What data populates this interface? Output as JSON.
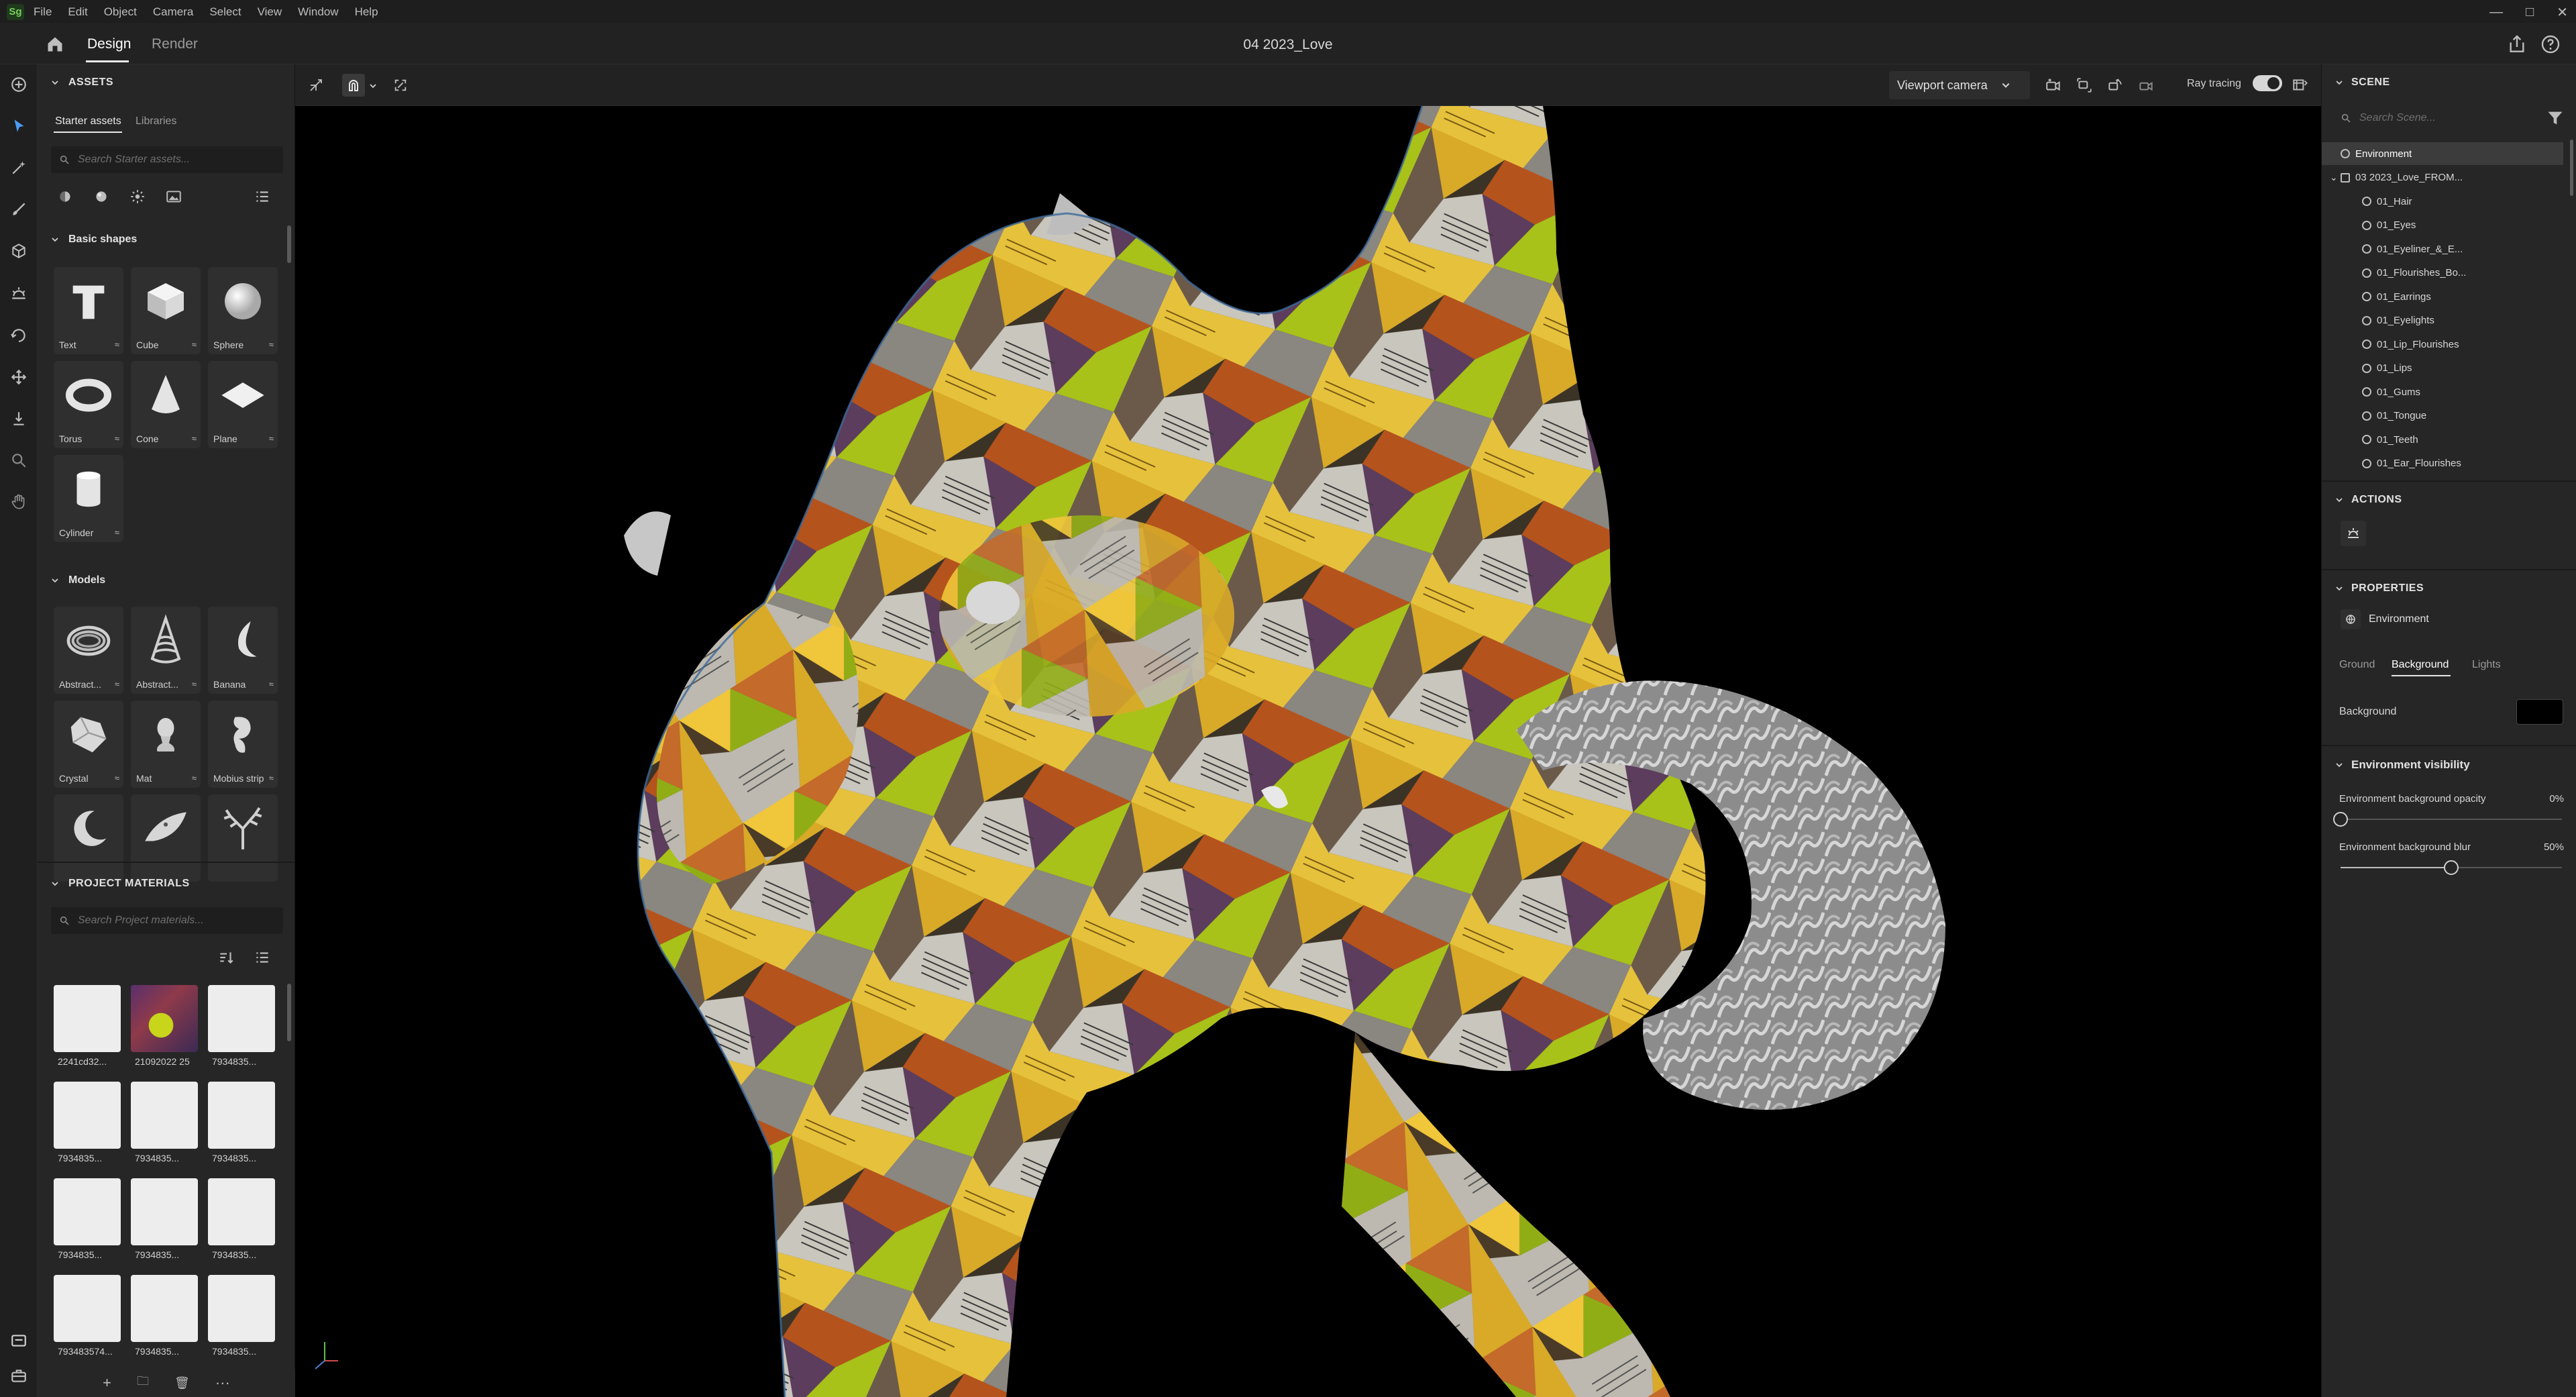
{
  "menubar": {
    "logo": "Sg",
    "items": [
      "File",
      "Edit",
      "Object",
      "Camera",
      "Select",
      "View",
      "Window",
      "Help"
    ],
    "window_controls": {
      "minimize": "—",
      "maximize": "□",
      "close": "✕"
    }
  },
  "titlebar": {
    "tabs": {
      "design": "Design",
      "render": "Render"
    },
    "active_tab": "Design",
    "document_title": "04 2023_Love"
  },
  "assets": {
    "title": "ASSETS",
    "tabs": {
      "starter": "Starter assets",
      "libraries": "Libraries"
    },
    "search_placeholder": "Search Starter assets...",
    "basic_shapes_title": "Basic shapes",
    "basic_shapes": [
      {
        "label": "Text",
        "icon": "text-shape-icon"
      },
      {
        "label": "Cube",
        "icon": "cube-shape-icon"
      },
      {
        "label": "Sphere",
        "icon": "sphere-shape-icon"
      },
      {
        "label": "Torus",
        "icon": "torus-shape-icon"
      },
      {
        "label": "Cone",
        "icon": "cone-shape-icon"
      },
      {
        "label": "Plane",
        "icon": "plane-shape-icon"
      },
      {
        "label": "Cylinder",
        "icon": "cylinder-shape-icon"
      }
    ],
    "models_title": "Models",
    "models": [
      {
        "label": "Abstract...",
        "icon": "abstract-ring-icon"
      },
      {
        "label": "Abstract...",
        "icon": "abstract-spiral-icon"
      },
      {
        "label": "Banana",
        "icon": "banana-icon"
      },
      {
        "label": "Crystal",
        "icon": "crystal-icon"
      },
      {
        "label": "Mat",
        "icon": "bust-icon"
      },
      {
        "label": "Mobius strip",
        "icon": "mobius-icon"
      },
      {
        "label": "",
        "icon": "crescent-icon"
      },
      {
        "label": "",
        "icon": "leaf-icon"
      },
      {
        "label": "",
        "icon": "coral-icon"
      }
    ],
    "project_materials_title": "PROJECT MATERIALS",
    "materials_search_placeholder": "Search Project materials...",
    "materials": [
      {
        "label": "2241cd32...",
        "swatch": "#ededed"
      },
      {
        "label": "21092022 25",
        "swatch": "texture"
      },
      {
        "label": "7934835...",
        "swatch": "#ededed"
      },
      {
        "label": "7934835...",
        "swatch": "#ededed"
      },
      {
        "label": "7934835...",
        "swatch": "#ededed"
      },
      {
        "label": "7934835...",
        "swatch": "#ededed"
      },
      {
        "label": "7934835...",
        "swatch": "#ededed"
      },
      {
        "label": "7934835...",
        "swatch": "#ededed"
      },
      {
        "label": "7934835...",
        "swatch": "#ededed"
      },
      {
        "label": "793483574...",
        "swatch": "#ededed"
      },
      {
        "label": "7934835...",
        "swatch": "#ededed"
      },
      {
        "label": "7934835...",
        "swatch": "#ededed"
      }
    ],
    "footer": {
      "add": "+",
      "folder": "🗀",
      "delete": "🗑",
      "more": "···"
    }
  },
  "viewport": {
    "camera_select": "Viewport camera",
    "ray_tracing_label": "Ray tracing",
    "ray_tracing_on": true
  },
  "scene": {
    "title": "SCENE",
    "search_placeholder": "Search Scene...",
    "items": [
      {
        "label": "Environment",
        "depth": 0,
        "selected": true,
        "expander": ""
      },
      {
        "label": "03 2023_Love_FROM...",
        "depth": 0,
        "selected": false,
        "expander": "⌄"
      },
      {
        "label": "01_Hair",
        "depth": 1,
        "selected": false,
        "expander": ""
      },
      {
        "label": "01_Eyes",
        "depth": 1,
        "selected": false,
        "expander": ""
      },
      {
        "label": "01_Eyeliner_&_E...",
        "depth": 1,
        "selected": false,
        "expander": ""
      },
      {
        "label": "01_Flourishes_Bo...",
        "depth": 1,
        "selected": false,
        "expander": ""
      },
      {
        "label": "01_Earrings",
        "depth": 1,
        "selected": false,
        "expander": ""
      },
      {
        "label": "01_Eyelights",
        "depth": 1,
        "selected": false,
        "expander": ""
      },
      {
        "label": "01_Lip_Flourishes",
        "depth": 1,
        "selected": false,
        "expander": ""
      },
      {
        "label": "01_Lips",
        "depth": 1,
        "selected": false,
        "expander": ""
      },
      {
        "label": "01_Gums",
        "depth": 1,
        "selected": false,
        "expander": ""
      },
      {
        "label": "01_Tongue",
        "depth": 1,
        "selected": false,
        "expander": ""
      },
      {
        "label": "01_Teeth",
        "depth": 1,
        "selected": false,
        "expander": ""
      },
      {
        "label": "01_Ear_Flourishes",
        "depth": 1,
        "selected": false,
        "expander": ""
      }
    ]
  },
  "actions": {
    "title": "ACTIONS"
  },
  "properties": {
    "title": "PROPERTIES",
    "object": "Environment",
    "tabs": {
      "ground": "Ground",
      "background": "Background",
      "lights": "Lights"
    },
    "active_tab": "Background",
    "background_label": "Background",
    "background_color": "#000000",
    "env_visibility_title": "Environment visibility",
    "opacity_label": "Environment background opacity",
    "opacity_value": "0%",
    "opacity_fraction": 0,
    "blur_label": "Environment background blur",
    "blur_value": "50%",
    "blur_fraction": 0.5
  },
  "colors": {
    "accent": "#e8e8e8",
    "panel": "#262626",
    "viewport": "#000000",
    "gold": "#d8a92a",
    "lime": "#a9c218",
    "rust": "#b4521c"
  }
}
